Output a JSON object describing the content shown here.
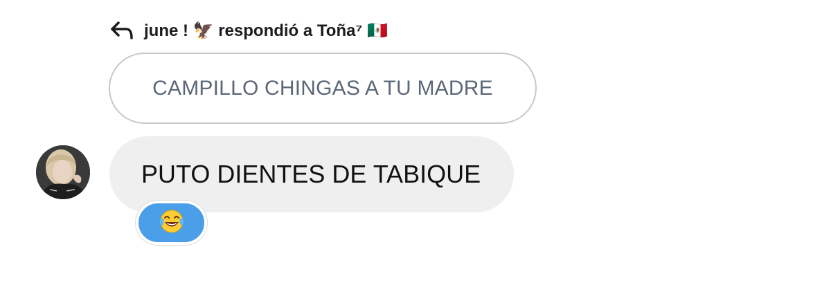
{
  "reply_header": {
    "icon": "reply-arrow-icon",
    "text": "june ! 🦅 respondió a Toña⁷ 🇲🇽"
  },
  "quoted_message": {
    "text": "CAMPILLO CHINGAS A TU MADRE"
  },
  "message": {
    "avatar": "user-avatar",
    "text": "PUTO DIENTES DE TABIQUE"
  },
  "reaction": {
    "icon": "tears-of-joy-emoji-icon"
  },
  "colors": {
    "quoted_border": "#c8c8cc",
    "quoted_text": "#5b6878",
    "bubble_bg": "#efeff0",
    "reaction_bg": "#4a9fe8"
  }
}
